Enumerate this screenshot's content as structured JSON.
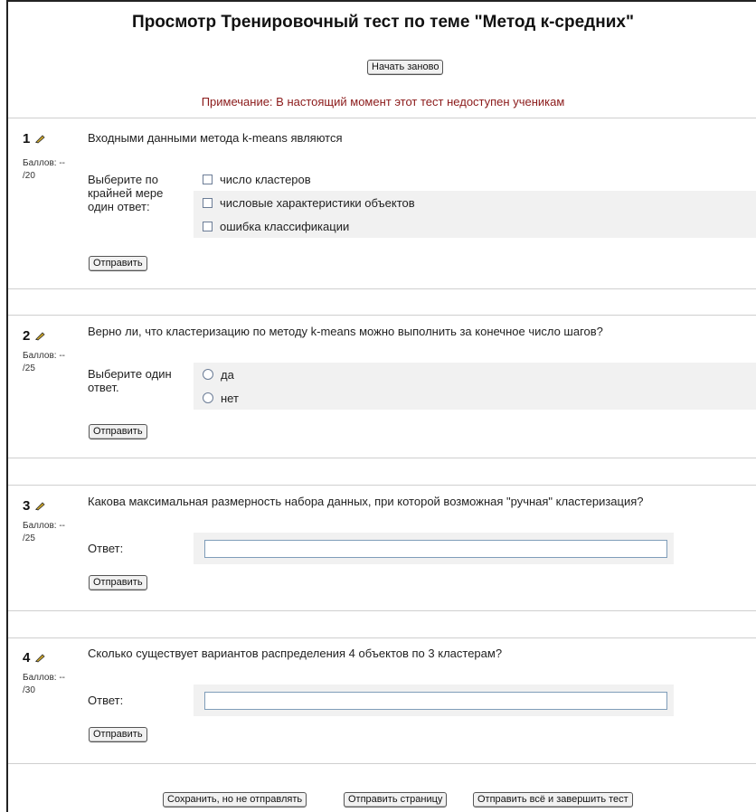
{
  "title": "Просмотр Тренировочный тест по теме \"Метод к-средних\"",
  "restart_label": "Начать заново",
  "note": "Примечание: В настоящий момент этот тест недоступен ученикам",
  "submit_label": "Отправить",
  "grade_label": "Баллов: --",
  "questions": [
    {
      "number": "1",
      "max": "/20",
      "text": "Входными данными метода k-means являются",
      "prompt": "Выберите по крайней мере один ответ:",
      "options": [
        "число кластеров",
        "числовые характеристики объектов",
        "ошибка классификации"
      ]
    },
    {
      "number": "2",
      "max": "/25",
      "text": "Верно ли, что кластеризацию по методу k-means можно выполнить за конечное число шагов?",
      "prompt": "Выберите один ответ.",
      "options": [
        "да",
        "нет"
      ]
    },
    {
      "number": "3",
      "max": "/25",
      "text": "Какова максимальная размерность набора данных, при которой возможная \"ручная\" кластеризация?",
      "prompt": "Ответ:",
      "answer_value": ""
    },
    {
      "number": "4",
      "max": "/30",
      "text": "Сколько существует вариантов распределения 4 объектов по 3 кластерам?",
      "prompt": "Ответ:",
      "answer_value": ""
    }
  ],
  "footer": {
    "save_label": "Сохранить, но не отправлять",
    "submit_page_label": "Отправить страницу",
    "submit_all_label": "Отправить всё и завершить тест"
  }
}
